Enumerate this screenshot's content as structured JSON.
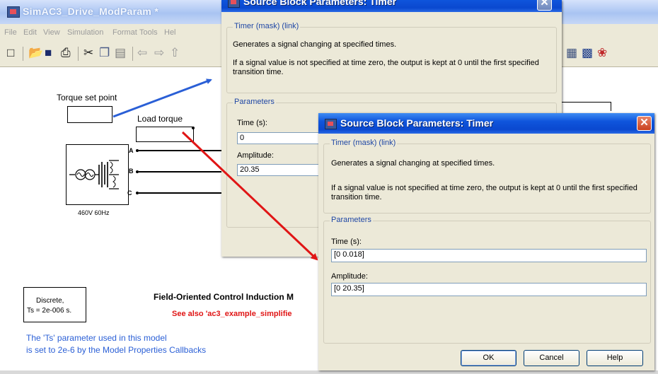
{
  "main_window": {
    "title": "SimAC3_Drive_ModParam *",
    "menu": [
      "File",
      "Edit",
      "View",
      "Simulation",
      "Format",
      "Tools",
      "Hel"
    ],
    "toolbar_icons": [
      "new-file-icon",
      "open-icon",
      "save-icon",
      "print-icon",
      "cut-icon",
      "copy-icon",
      "paste-icon",
      "back-arrow-icon",
      "forward-arrow-icon",
      "up-arrow-icon"
    ],
    "toolbar_right_icons": [
      "library-browser-icon",
      "model-explorer-icon",
      "debug-icon"
    ]
  },
  "canvas": {
    "torque_set_point_label": "Torque set point",
    "load_torque_label": "Load torque",
    "source_label": "460V 60Hz",
    "phase_labels": [
      "A",
      "B",
      "C"
    ],
    "discrete_block": {
      "line1": "Discrete,",
      "line2": "Ts = 2e-006 s."
    },
    "model_title": "Field-Oriented Control Induction M",
    "see_also": "See also 'ac3_example_simplifie",
    "note_line1": "The 'Ts' parameter used in this model",
    "note_line2": "is set to 2e-6  by the Model Properties Callbacks",
    "accent_blue": "#2a5fd6",
    "accent_red": "#e01515"
  },
  "dialog_back": {
    "title": "Source Block Parameters: Timer",
    "mask_group": "Timer (mask) (link)",
    "desc1": "Generates a signal changing at specified times.",
    "desc2": "If a signal value is not specified at time zero, the output is kept at 0 until the first specified transition time.",
    "params_group": "Parameters",
    "time_label": "Time (s):",
    "time_value": "0",
    "amp_label": "Amplitude:",
    "amp_value": "20.35"
  },
  "dialog_front": {
    "title": "Source Block Parameters: Timer",
    "close": "✕",
    "mask_group": "Timer (mask) (link)",
    "desc1": "Generates a signal changing at specified times.",
    "desc2": "If a signal value is not specified at time zero, the output is kept at 0 until the first specified transition time.",
    "params_group": "Parameters",
    "time_label": "Time (s):",
    "time_value": "[0 0.018]",
    "amp_label": "Amplitude:",
    "amp_value": "[0 20.35]",
    "ok": "OK",
    "cancel": "Cancel",
    "help": "Help"
  }
}
